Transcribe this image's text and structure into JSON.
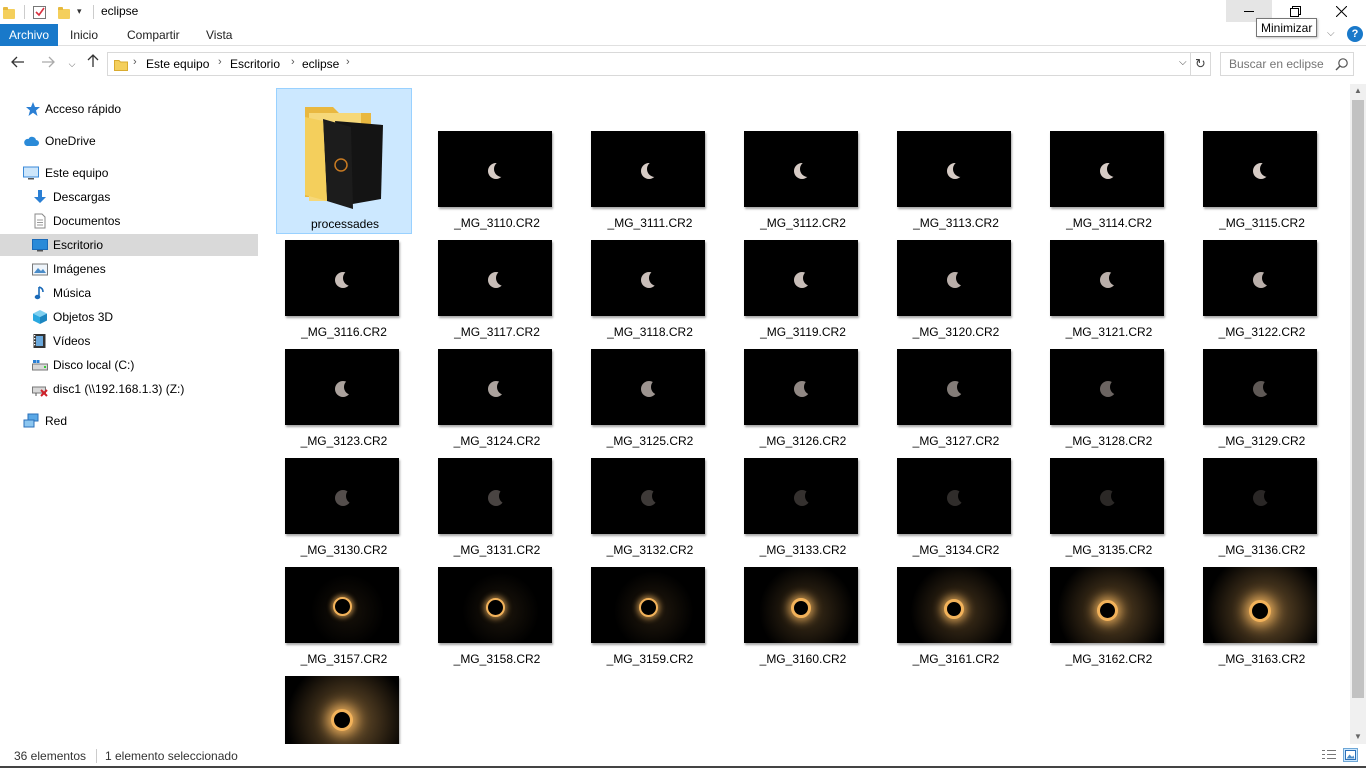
{
  "window": {
    "title": "eclipse",
    "minimize_tooltip": "Minimizar",
    "controls": [
      "minimize-icon",
      "maximize-icon",
      "close-icon"
    ]
  },
  "ribbon": {
    "tabs": [
      "Archivo",
      "Inicio",
      "Compartir",
      "Vista"
    ],
    "help": "?"
  },
  "address": {
    "crumbs": [
      "Este equipo",
      "Escritorio",
      "eclipse"
    ]
  },
  "search": {
    "placeholder": "Buscar en eclipse"
  },
  "nav": {
    "items": [
      {
        "label": "Acceso rápido",
        "icon": "star-icon"
      },
      {
        "label": "OneDrive",
        "icon": "cloud-icon"
      },
      {
        "label": "Este equipo",
        "icon": "computer-icon"
      },
      {
        "label": "Descargas",
        "icon": "download-icon"
      },
      {
        "label": "Documentos",
        "icon": "document-icon"
      },
      {
        "label": "Escritorio",
        "icon": "desktop-icon",
        "selected": true
      },
      {
        "label": "Imágenes",
        "icon": "image-icon"
      },
      {
        "label": "Música",
        "icon": "music-icon"
      },
      {
        "label": "Objetos 3D",
        "icon": "cube-icon"
      },
      {
        "label": "Vídeos",
        "icon": "video-icon"
      },
      {
        "label": "Disco local (C:)",
        "icon": "drive-icon"
      },
      {
        "label": "disc1 (\\\\192.168.1.3) (Z:)",
        "icon": "network-drive-disconnected-icon"
      },
      {
        "label": "Red",
        "icon": "network-icon"
      }
    ]
  },
  "files": [
    {
      "name": "processades",
      "kind": "folder",
      "selected": true
    },
    {
      "name": "_MG_3110.CR2",
      "kind": "crescent",
      "phase": 0.55,
      "brightness": 0.95
    },
    {
      "name": "_MG_3111.CR2",
      "kind": "crescent",
      "phase": 0.55,
      "brightness": 0.95
    },
    {
      "name": "_MG_3112.CR2",
      "kind": "crescent",
      "phase": 0.55,
      "brightness": 0.95
    },
    {
      "name": "_MG_3113.CR2",
      "kind": "crescent",
      "phase": 0.55,
      "brightness": 0.95
    },
    {
      "name": "_MG_3114.CR2",
      "kind": "crescent",
      "phase": 0.45,
      "brightness": 0.95
    },
    {
      "name": "_MG_3115.CR2",
      "kind": "crescent",
      "phase": 0.45,
      "brightness": 0.95
    },
    {
      "name": "_MG_3116.CR2",
      "kind": "crescent",
      "phase": 0.35,
      "brightness": 0.9
    },
    {
      "name": "_MG_3117.CR2",
      "kind": "crescent",
      "phase": 0.35,
      "brightness": 0.9
    },
    {
      "name": "_MG_3118.CR2",
      "kind": "crescent",
      "phase": 0.35,
      "brightness": 0.9
    },
    {
      "name": "_MG_3119.CR2",
      "kind": "crescent",
      "phase": 0.3,
      "brightness": 0.9
    },
    {
      "name": "_MG_3120.CR2",
      "kind": "crescent",
      "phase": 0.3,
      "brightness": 0.85
    },
    {
      "name": "_MG_3121.CR2",
      "kind": "crescent",
      "phase": 0.3,
      "brightness": 0.85
    },
    {
      "name": "_MG_3122.CR2",
      "kind": "crescent",
      "phase": 0.3,
      "brightness": 0.85
    },
    {
      "name": "_MG_3123.CR2",
      "kind": "crescent",
      "phase": 0.25,
      "brightness": 0.8
    },
    {
      "name": "_MG_3124.CR2",
      "kind": "crescent",
      "phase": 0.25,
      "brightness": 0.8
    },
    {
      "name": "_MG_3125.CR2",
      "kind": "crescent",
      "phase": 0.2,
      "brightness": 0.75
    },
    {
      "name": "_MG_3126.CR2",
      "kind": "crescent",
      "phase": 0.18,
      "brightness": 0.7
    },
    {
      "name": "_MG_3127.CR2",
      "kind": "crescent",
      "phase": 0.16,
      "brightness": 0.65
    },
    {
      "name": "_MG_3128.CR2",
      "kind": "crescent",
      "phase": 0.14,
      "brightness": 0.55
    },
    {
      "name": "_MG_3129.CR2",
      "kind": "crescent",
      "phase": 0.12,
      "brightness": 0.5
    },
    {
      "name": "_MG_3130.CR2",
      "kind": "crescent",
      "phase": 0.1,
      "brightness": 0.45
    },
    {
      "name": "_MG_3131.CR2",
      "kind": "crescent",
      "phase": 0.1,
      "brightness": 0.4
    },
    {
      "name": "_MG_3132.CR2",
      "kind": "crescent",
      "phase": 0.1,
      "brightness": 0.35
    },
    {
      "name": "_MG_3133.CR2",
      "kind": "crescent",
      "phase": 0.08,
      "brightness": 0.3
    },
    {
      "name": "_MG_3134.CR2",
      "kind": "crescent",
      "phase": 0.08,
      "brightness": 0.28
    },
    {
      "name": "_MG_3135.CR2",
      "kind": "crescent",
      "phase": 0.07,
      "brightness": 0.25
    },
    {
      "name": "_MG_3136.CR2",
      "kind": "crescent",
      "phase": 0.06,
      "brightness": 0.22
    },
    {
      "name": "_MG_3157.CR2",
      "kind": "ring",
      "glow": 0.2
    },
    {
      "name": "_MG_3158.CR2",
      "kind": "ring",
      "glow": 0.25
    },
    {
      "name": "_MG_3159.CR2",
      "kind": "ring",
      "glow": 0.3
    },
    {
      "name": "_MG_3160.CR2",
      "kind": "ring",
      "glow": 0.55
    },
    {
      "name": "_MG_3161.CR2",
      "kind": "ring",
      "glow": 0.6
    },
    {
      "name": "_MG_3162.CR2",
      "kind": "ring",
      "glow": 0.8
    },
    {
      "name": "_MG_3163.CR2",
      "kind": "ring",
      "glow": 0.95
    },
    {
      "name": "",
      "kind": "ring",
      "glow": 1.0
    }
  ],
  "status": {
    "count": "36 elementos",
    "selection": "1 elemento seleccionado"
  },
  "colors": {
    "accent": "#1979ca",
    "selection_bg": "#cce8ff",
    "selection_border": "#99d1ff",
    "nav_selected": "#d9d9d9"
  }
}
